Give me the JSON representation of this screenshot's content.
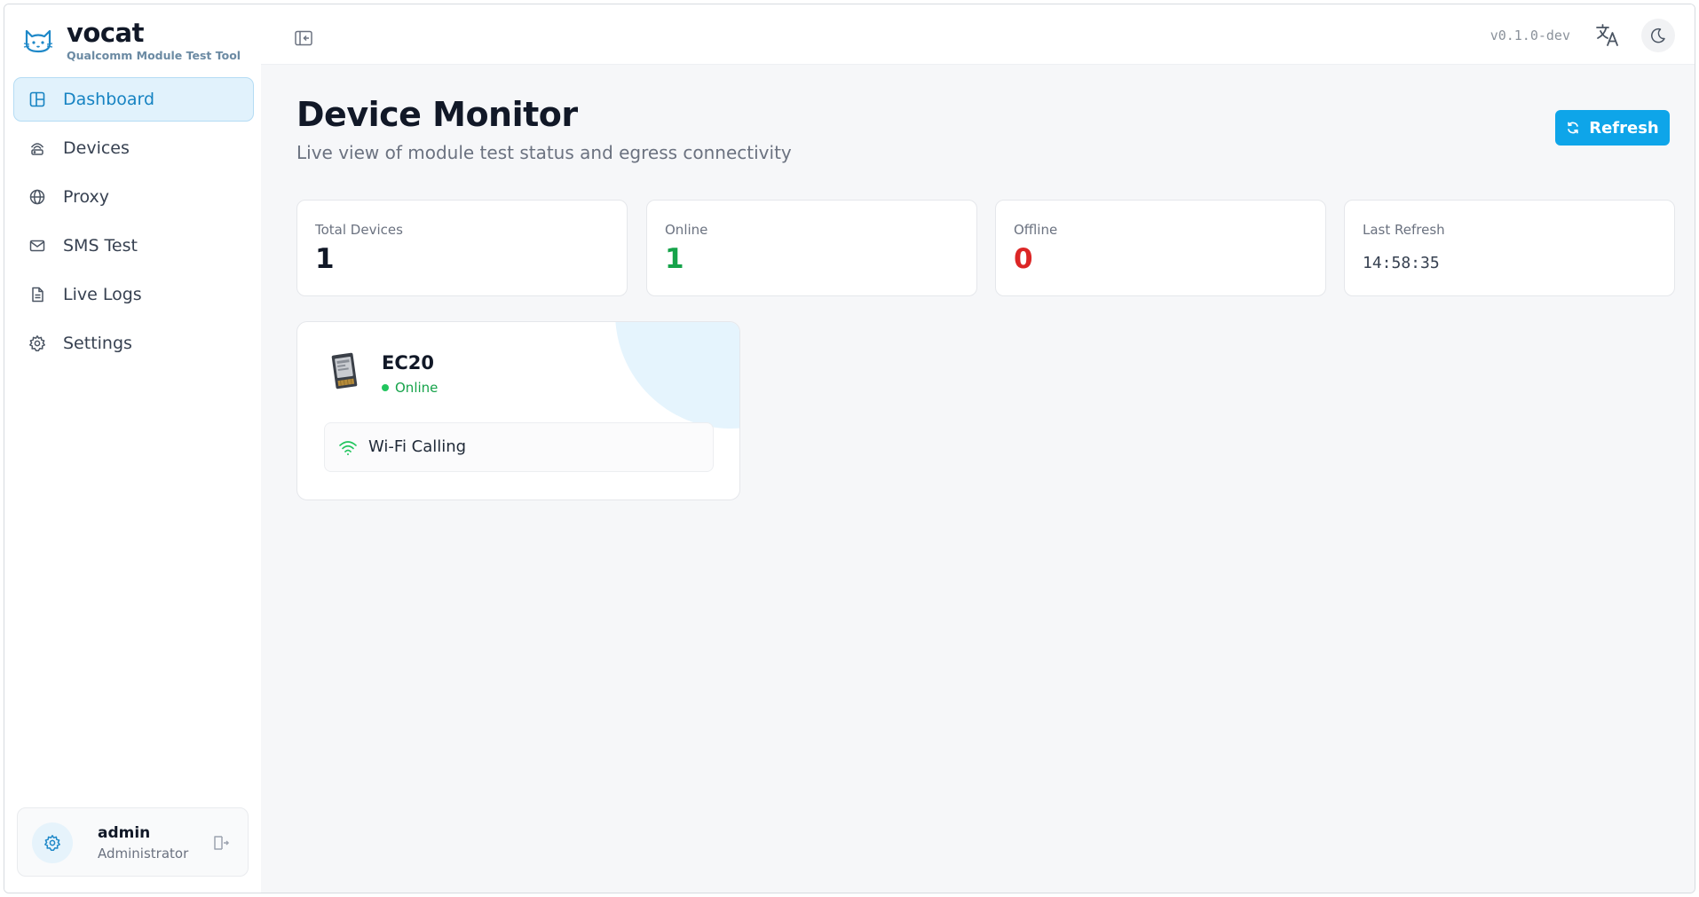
{
  "brand": {
    "name": "vocat",
    "subtitle": "Qualcomm Module Test Tool"
  },
  "sidebar": {
    "items": [
      {
        "label": "Dashboard",
        "icon": "dashboard-icon",
        "active": true
      },
      {
        "label": "Devices",
        "icon": "devices-icon",
        "active": false
      },
      {
        "label": "Proxy",
        "icon": "globe-icon",
        "active": false
      },
      {
        "label": "SMS Test",
        "icon": "mail-icon",
        "active": false
      },
      {
        "label": "Live Logs",
        "icon": "file-icon",
        "active": false
      },
      {
        "label": "Settings",
        "icon": "gear-icon",
        "active": false
      }
    ]
  },
  "user": {
    "name": "admin",
    "role": "Administrator"
  },
  "topbar": {
    "version": "v0.1.0-dev"
  },
  "page": {
    "title": "Device Monitor",
    "subtitle": "Live view of module test status and egress connectivity",
    "refresh_label": "Refresh"
  },
  "stats": {
    "total": {
      "label": "Total Devices",
      "value": "1"
    },
    "online": {
      "label": "Online",
      "value": "1"
    },
    "offline": {
      "label": "Offline",
      "value": "0"
    },
    "last_refresh": {
      "label": "Last Refresh",
      "value": "14:58:35"
    }
  },
  "device": {
    "name": "EC20",
    "status": "Online",
    "feature": "Wi-Fi Calling"
  },
  "colors": {
    "accent": "#0ea5e9",
    "active_bg": "#e1f2fc",
    "online": "#16a34a",
    "offline": "#dc2626"
  }
}
